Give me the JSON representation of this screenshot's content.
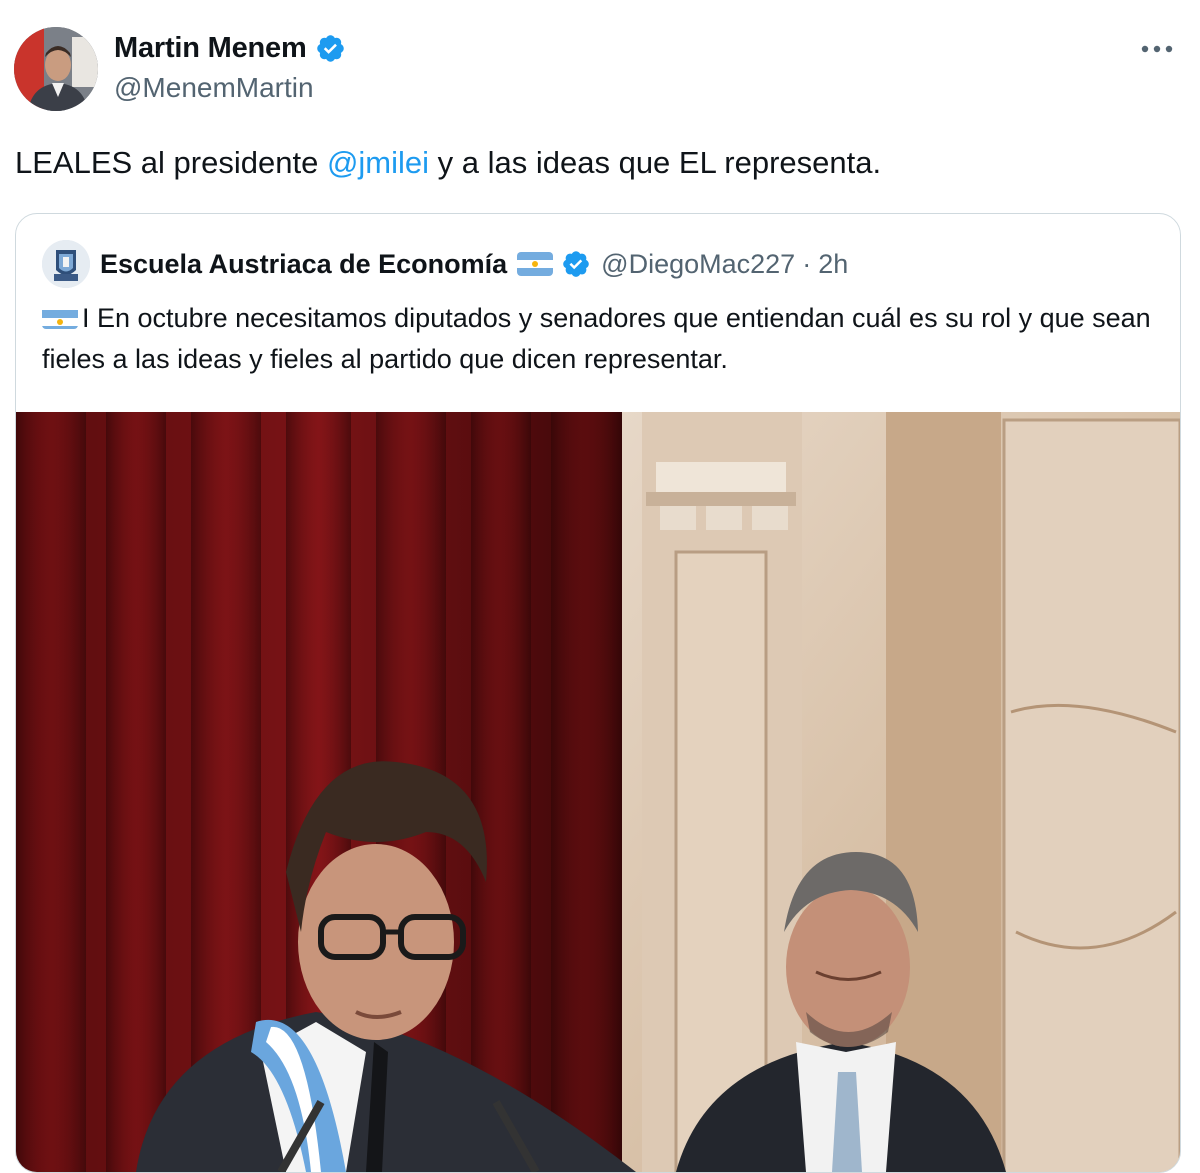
{
  "tweet": {
    "author": {
      "name": "Martin Menem",
      "handle": "@MenemMartin",
      "verified": true
    },
    "text": {
      "before": "LEALES al presidente ",
      "mention": "@jmilei",
      "after": " y a las ideas que EL representa."
    },
    "more_icon": "more-horizontal-icon"
  },
  "quoted": {
    "author": {
      "name": "Escuela Austriaca de Economía",
      "flag": "argentina-flag",
      "verified": true,
      "handle": "@DiegoMac227",
      "separator": "·",
      "time": "2h"
    },
    "text": {
      "flag": "argentina-flag",
      "body": "I En octubre necesitamos diputados y senadores que entiendan cuál es su rol y que sean fieles a las ideas y fieles al partido que dicen representar."
    },
    "media": {
      "description_icon": "photo"
    }
  },
  "colors": {
    "link": "#1d9bf0",
    "verified": "#1d9bf0",
    "secondary_text": "#536471",
    "border": "#cfd9de"
  }
}
